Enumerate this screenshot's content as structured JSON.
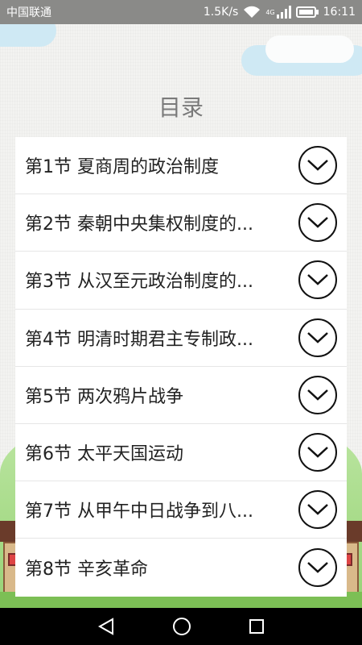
{
  "status_bar": {
    "carrier": "中国联通",
    "speed": "1.5K/s",
    "network": "4G",
    "time": "16:11"
  },
  "page": {
    "title": "目录"
  },
  "chapters": [
    {
      "label": "第1节 夏商周的政治制度"
    },
    {
      "label": "第2节 秦朝中央集权制度的..."
    },
    {
      "label": "第3节 从汉至元政治制度的..."
    },
    {
      "label": "第4节 明清时期君主专制政..."
    },
    {
      "label": "第5节 两次鸦片战争"
    },
    {
      "label": "第6节 太平天国运动"
    },
    {
      "label": "第7节 从甲午中日战争到八..."
    },
    {
      "label": "第8节 辛亥革命"
    }
  ],
  "icons": {
    "expand": "chevron-down-icon",
    "nav_back": "back-triangle-icon",
    "nav_home": "home-circle-icon",
    "nav_recent": "recent-square-icon"
  },
  "colors": {
    "status_bar": "#8a8a88",
    "title": "#7a7a7a",
    "list_bg": "#ffffff",
    "nav_bar": "#000000"
  }
}
